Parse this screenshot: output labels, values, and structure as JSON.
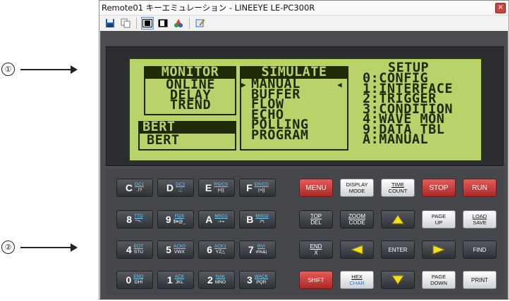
{
  "callouts": {
    "one": "①",
    "two": "②"
  },
  "window": {
    "title": "Remote01 キーエミュレーション - LINEEYE LE-PC300R",
    "close": "×"
  },
  "toolbar": {
    "icons": [
      "save-icon",
      "copy-icon",
      "display-mode-1-icon",
      "display-mode-2-icon",
      "color-icon",
      "edit-icon"
    ]
  },
  "lcd": {
    "monitor_header": "MONITOR",
    "monitor_items": "ONLINE\nDELAY\nTREND",
    "bert_header": "BERT",
    "bert_item": "BERT",
    "simulate_header": "SIMULATE",
    "cursor_left": "▶",
    "cursor_right": "◀",
    "simulate_items": "MANUAL\nBUFFER\nFLOW\nECHO\nPOLLING\nPROGRAM",
    "setup_title": "SETUP",
    "setup_items": "0:CONFIG\n1:INTERFACE\n2:TRIGGER\n3:CONDITION\n4:WAVE MON\n9:DATA TBL\nA:MANUAL"
  },
  "keys": {
    "c": {
      "big": "C",
      "top": "DC1",
      "bottom": ".!?"
    },
    "d": {
      "big": "D",
      "top": "DC3",
      "bottom": ".;;"
    },
    "e": {
      "big": "E",
      "top": "RS/CS",
      "bottom": "|<[{"
    },
    "f": {
      "big": "F",
      "top": "ER/CD",
      "bottom": "|>}]"
    },
    "menu": "MENU",
    "display_mode": {
      "top": "DISPLAY",
      "bottom": "MODE"
    },
    "time_count": {
      "top": "TIME",
      "bottom": "COUNT"
    },
    "stop": "STOP",
    "run": "RUN",
    "k8": {
      "big": "8",
      "top": "TTD",
      "bottom": "\"'^-"
    },
    "k9": {
      "big": "9",
      "top": "FOX",
      "bottom": "$¥@_"
    },
    "a": {
      "big": "A",
      "top": "MSG1",
      "bottom": "-+="
    },
    "b": {
      "big": "B",
      "top": "MSG2",
      "bottom": "/*\\"
    },
    "top_del": {
      "top": "TOP",
      "bottom": "DEL"
    },
    "zoom_code": {
      "top": "ZOOM",
      "bottom": "CODE"
    },
    "page_up": {
      "top": "PAGE",
      "bottom": "UP"
    },
    "load_save": {
      "top": "LOAD",
      "bottom": "SAVE"
    },
    "k4": {
      "big": "4",
      "top": "EOT",
      "bottom": "STU"
    },
    "k5": {
      "big": "5",
      "top": "ACK0",
      "bottom": "VWX"
    },
    "k6": {
      "big": "6",
      "top": "ACK1",
      "bottom": "YZ△"
    },
    "k7": {
      "big": "7",
      "top": "RVI",
      "bottom": "#%&|"
    },
    "end_x": {
      "top": "END",
      "bottom": "X"
    },
    "enter": "ENTER",
    "find": "FIND",
    "k0": {
      "big": "0",
      "top": "ENQ",
      "bottom": "GHI"
    },
    "k1": {
      "big": "1",
      "top": "ACK",
      "bottom": "JKL"
    },
    "k2": {
      "big": "2",
      "top": "NAK",
      "bottom": "MNO"
    },
    "k3": {
      "big": "3",
      "top": "WACK",
      "bottom": "PQR"
    },
    "shift": "SHIFT",
    "hex_char": {
      "top": "HEX",
      "bottom": "CHAR"
    },
    "page_down": {
      "top": "PAGE",
      "bottom": "DOWN"
    },
    "print": "PRINT"
  },
  "colors": {
    "lcd_bg": "#b7d36a",
    "lcd_text": "#1f2a08",
    "red_key": "#d9413e",
    "arrow_yellow": "#f3e11a"
  }
}
